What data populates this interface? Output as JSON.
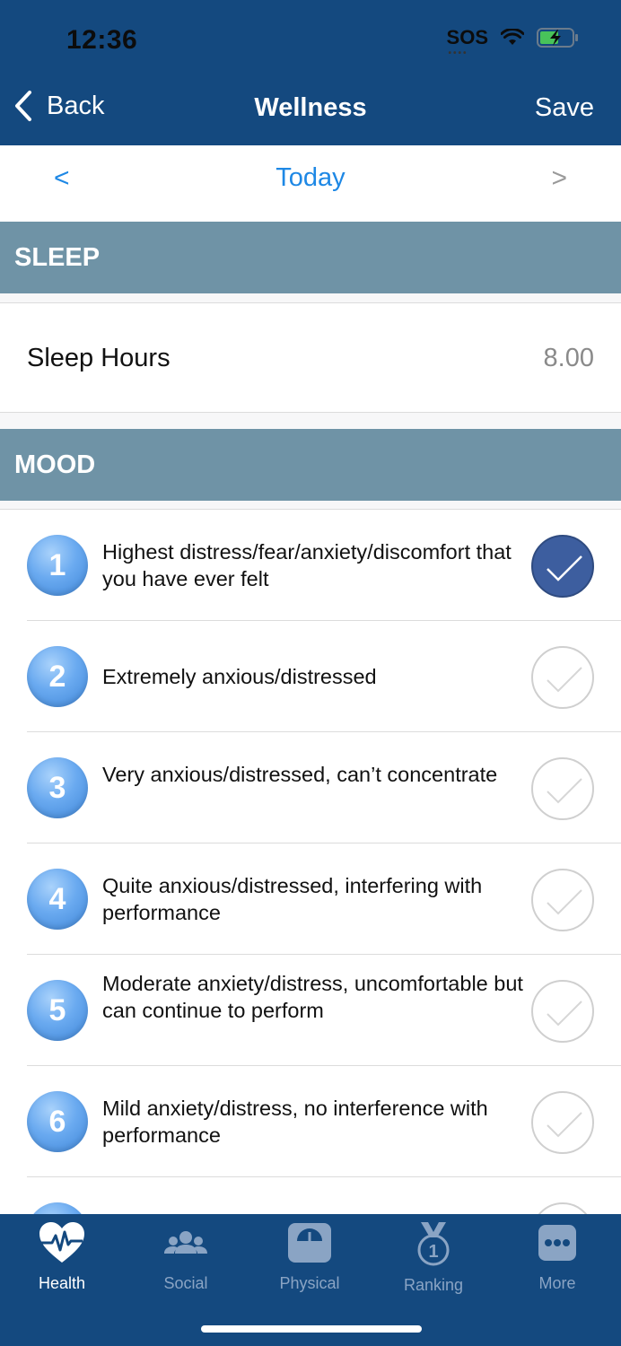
{
  "status": {
    "time": "12:36",
    "sos": "SOS"
  },
  "nav": {
    "back_label": "Back",
    "title": "Wellness",
    "save_label": "Save"
  },
  "date": {
    "prev": "<",
    "label": "Today",
    "next": ">"
  },
  "sleep": {
    "header": "SLEEP",
    "label": "Sleep Hours",
    "value": "8.00"
  },
  "mood": {
    "header": "MOOD",
    "items": [
      {
        "num": "1",
        "text": "Highest distress/fear/anxiety/discomfort that you have ever felt",
        "checked": true
      },
      {
        "num": "2",
        "text": "Extremely anxious/distressed",
        "checked": false
      },
      {
        "num": "3",
        "text": "Very anxious/distressed, can’t concentrate",
        "checked": false
      },
      {
        "num": "4",
        "text": "Quite anxious/distressed, interfering with performance",
        "checked": false
      },
      {
        "num": "5",
        "text": "Moderate anxiety/distress, uncomfortable but can continue to perform",
        "checked": false
      },
      {
        "num": "6",
        "text": "Mild anxiety/distress, no interference with performance",
        "checked": false
      }
    ]
  },
  "tabs": [
    {
      "label": "Health",
      "icon": "heart-pulse-icon",
      "active": true
    },
    {
      "label": "Social",
      "icon": "people-icon",
      "active": false
    },
    {
      "label": "Physical",
      "icon": "scale-icon",
      "active": false
    },
    {
      "label": "Ranking",
      "icon": "medal-icon",
      "active": false
    },
    {
      "label": "More",
      "icon": "more-icon",
      "active": false
    }
  ],
  "colors": {
    "header": "#14497f",
    "section": "#6f93a6",
    "accent": "#1e88e5",
    "checked": "#3d5e9f"
  }
}
